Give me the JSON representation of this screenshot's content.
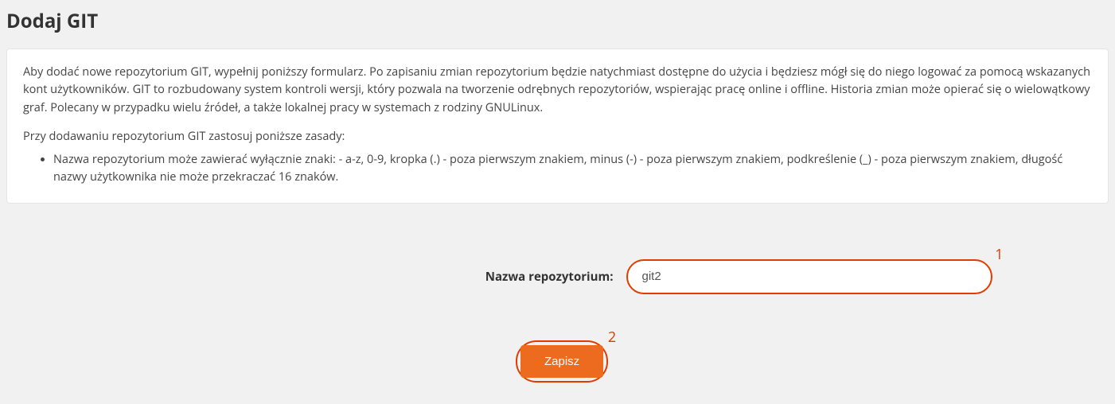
{
  "page": {
    "title": "Dodaj GIT"
  },
  "info": {
    "paragraph1": "Aby dodać nowe repozytorium GIT, wypełnij poniższy formularz. Po zapisaniu zmian repozytorium będzie natychmiast dostępne do użycia i będziesz mógł się do niego logować za pomocą wskazanych kont użytkowników. GIT to rozbudowany system kontroli wersji, który pozwala na tworzenie odrębnych repozytoriów, wspierając pracę online i offline. Historia zmian może opierać się o wielowątkowy graf. Polecany w przypadku wielu źródeł, a także lokalnej pracy w systemach z rodziny GNULinux.",
    "paragraph2": "Przy dodawaniu repozytorium GIT zastosuj poniższe zasady:",
    "rule1": "Nazwa repozytorium może zawierać wyłącznie znaki: - a-z, 0-9, kropka (.) - poza pierwszym znakiem, minus (-) - poza pierwszym znakiem, podkreślenie (_) - poza pierwszym znakiem, długość nazwy użytkownika nie może przekraczać 16 znaków."
  },
  "form": {
    "repo_label": "Nazwa repozytorium:",
    "repo_value": "git2",
    "save_label": "Zapisz"
  },
  "annotations": {
    "input": "1",
    "button": "2"
  }
}
